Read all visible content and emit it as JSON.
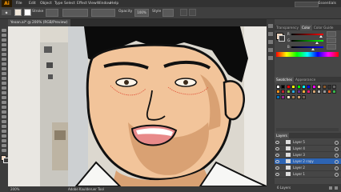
{
  "app": {
    "logo": "Ai",
    "workspace": "Essentials"
  },
  "menu": [
    "File",
    "Edit",
    "Object",
    "Type",
    "Select",
    "Effect",
    "View",
    "Window",
    "Help"
  ],
  "control_bar": {
    "stroke_label": "Stroke",
    "opacity_label": "Opacity",
    "opacity_value": "100%",
    "style_label": "Style"
  },
  "document": {
    "tab_title": "Yeoan.ai* @ 200% (RGB/Preview)"
  },
  "status": {
    "zoom": "200%",
    "tool": "Adobe Kaulderuer Tool"
  },
  "panels": {
    "color": {
      "tabs": [
        "Transparency",
        "Color",
        "Color Guide"
      ],
      "active": "Color",
      "channels": [
        "R",
        "G",
        "B"
      ]
    },
    "swatches": {
      "tabs": [
        "Swatches",
        "Appearance"
      ],
      "active": "Swatches",
      "colors": [
        "#ffffff",
        "#000000",
        "#ff0000",
        "#ffff00",
        "#00ff00",
        "#00ffff",
        "#0000ff",
        "#ff00ff",
        "#e6c99a",
        "#8c5a2b",
        "#333333",
        "#666666",
        "#f7931e",
        "#c1272d",
        "#8cc63f",
        "#29abe2",
        "#662d91",
        "#fbb03b",
        "#ed1e79",
        "#d4a373",
        "#b3b3b3",
        "#999999",
        "#f15a24",
        "#39b54a",
        "#0071bc",
        "#93278f",
        "#ffe6cc",
        "#a67c52",
        "#c69c6d",
        "#736357"
      ]
    },
    "layers": {
      "title": "Layers",
      "rows": [
        "Layer 5",
        "Layer 4",
        "Layer 3",
        "Layer 2 copy",
        "Layer 2",
        "Layer 1"
      ],
      "selected": "Layer 2 copy",
      "footer": "6 Layers"
    }
  }
}
